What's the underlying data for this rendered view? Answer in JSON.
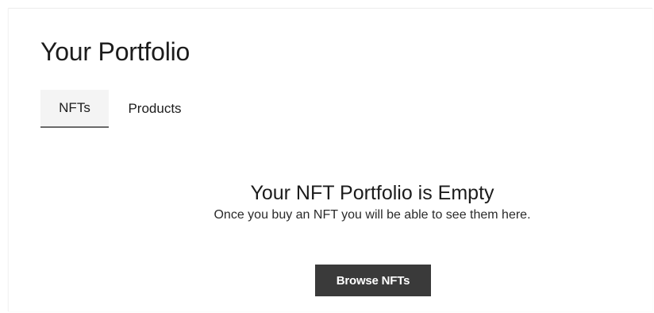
{
  "header": {
    "title": "Your Portfolio"
  },
  "tabs": [
    {
      "label": "NFTs",
      "active": true
    },
    {
      "label": "Products",
      "active": false
    }
  ],
  "empty_state": {
    "title": "Your NFT Portfolio is Empty",
    "subtitle": "Once you buy an NFT you will be able to see them here.",
    "button_label": "Browse NFTs"
  },
  "colors": {
    "button_background": "#3a3a3a",
    "button_text": "#ffffff",
    "active_tab_background": "#f4f4f4",
    "active_tab_indicator": "#6a6a6a"
  }
}
